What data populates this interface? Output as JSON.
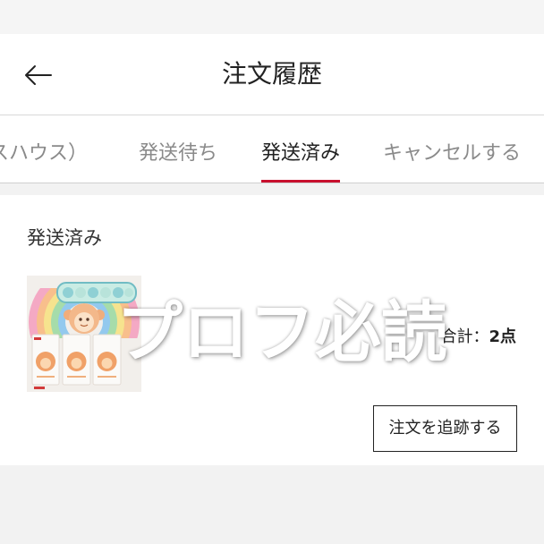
{
  "header": {
    "title": "注文履歴",
    "back_icon": "arrow-left-icon"
  },
  "tabs": [
    {
      "label": "スハウス）",
      "active": false
    },
    {
      "label": "発送待ち",
      "active": false
    },
    {
      "label": "発送済み",
      "active": true
    },
    {
      "label": "キャンセルする",
      "active": false
    }
  ],
  "order": {
    "status": "発送済み",
    "total_label": "合計：",
    "total_count": "2点",
    "track_button_label": "注文を追跡する"
  },
  "watermark": {
    "text": "プロフ必読"
  },
  "colors": {
    "accent": "#c8102e",
    "inactive_tab": "#8a8a8a",
    "text": "#222222",
    "page_background": "#f2f2f2"
  }
}
